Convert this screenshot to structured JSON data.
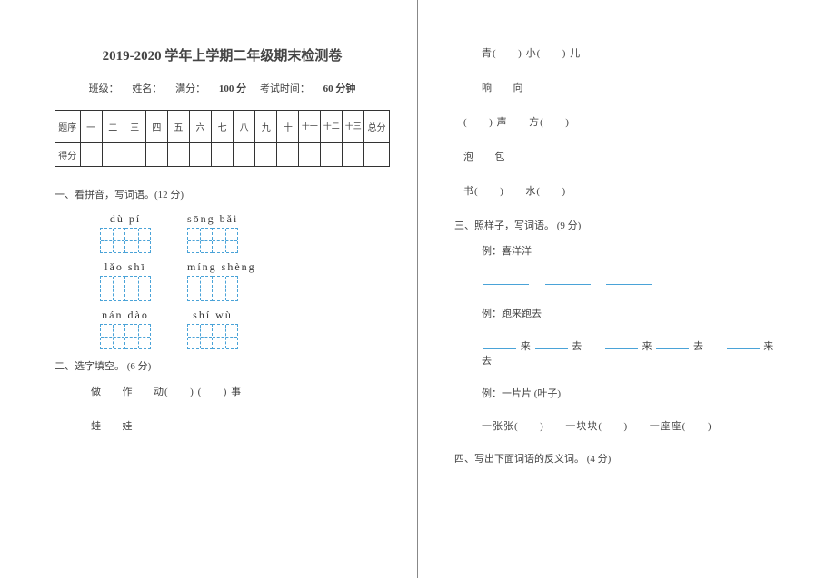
{
  "header": {
    "title": "2019-2020 学年上学期二年级期末检测卷",
    "class_label": "班级：",
    "name_label": "姓名：",
    "full_label": "满分：",
    "full_value": "100 分",
    "time_label": "考试时间：",
    "time_value": "60 分钟"
  },
  "score_table": {
    "row1_hdr": "题序",
    "cols": [
      "一",
      "二",
      "三",
      "四",
      "五",
      "六",
      "七",
      "八",
      "九",
      "十",
      "十一",
      "十二",
      "十三"
    ],
    "last": "总分",
    "row2_hdr": "得分"
  },
  "q1": {
    "title": "一、看拼音，写词语。(12 分)",
    "pinyin": [
      [
        "dù  pí",
        "sōng  bǎi"
      ],
      [
        "lǎo  shī",
        "míng shèng"
      ],
      [
        "nán  dào",
        "shí  wù"
      ]
    ]
  },
  "q2": {
    "title": "二、选字填空。 (6 分)",
    "row1_a": "做",
    "row1_b": "作",
    "row1_c": "动(",
    "row1_d": ") (",
    "row1_e": ") 事",
    "row2_a": "蛙",
    "row2_b": "娃"
  },
  "right": {
    "l1_a": "青(",
    "l1_b": ") 小(",
    "l1_c": ") 儿",
    "l2_a": "响",
    "l2_b": "向",
    "l3_a": "(",
    "l3_b": ") 声",
    "l3_c": "方(",
    "l3_d": ")",
    "l4_a": "泡",
    "l4_b": "包",
    "l5_a": "书(",
    "l5_b": ")",
    "l5_c": "水(",
    "l5_d": ")"
  },
  "q3": {
    "title": "三、照样子，写词语。 (9 分)",
    "ex1": "例：喜洋洋",
    "ex2": "例：跑来跑去",
    "row2_a": "来",
    "row2_b": "去",
    "row2_c": "来",
    "row2_d": "去",
    "row2_e": "来",
    "row2_f": "去",
    "ex3": "例：一片片 (叶子)",
    "row3_a": "一张张(",
    "row3_b": ")",
    "row3_c": "一块块(",
    "row3_d": ")",
    "row3_e": "一座座(",
    "row3_f": ")"
  },
  "q4": {
    "title": "四、写出下面词语的反义词。 (4 分)"
  }
}
